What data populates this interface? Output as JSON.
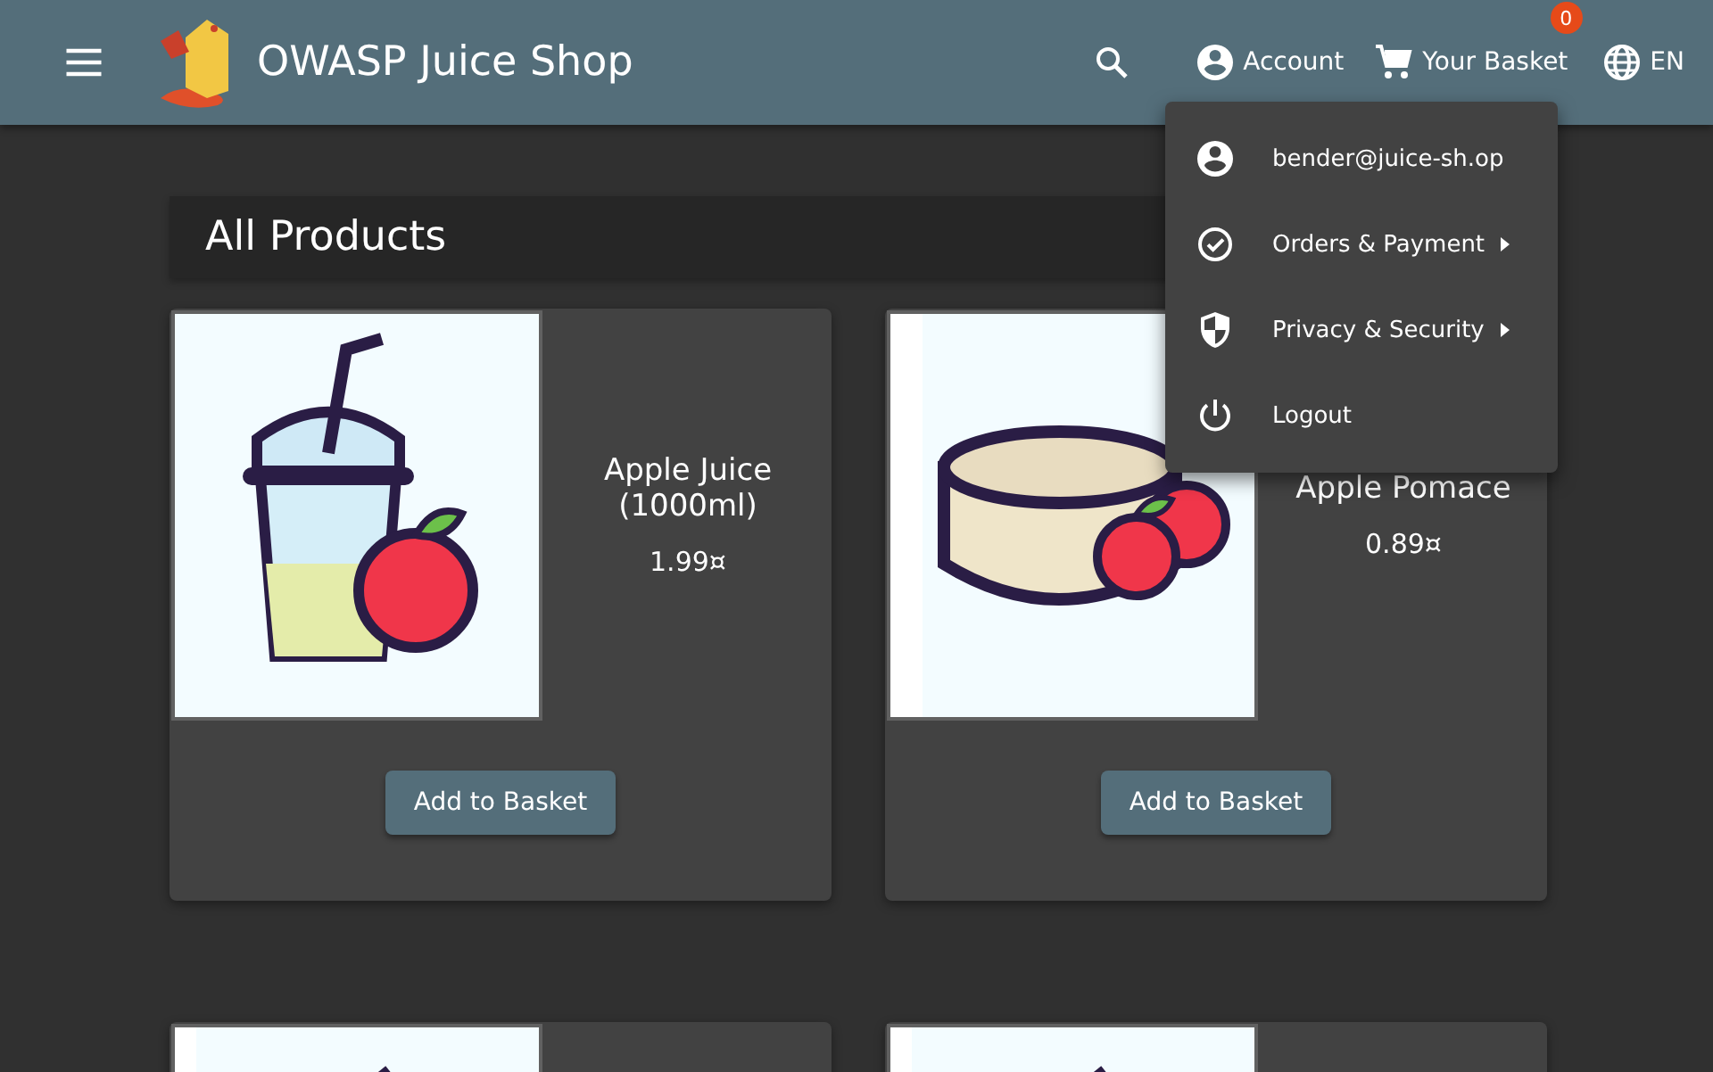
{
  "toolbar": {
    "title": "OWASP Juice Shop",
    "account": "Account",
    "basket": "Your Basket",
    "basket_count": "0",
    "language": "EN"
  },
  "account_menu": {
    "items": [
      {
        "kind": "user",
        "label": "bender@juice-sh.op",
        "submenu": false
      },
      {
        "kind": "orders",
        "label": "Orders & Payment",
        "submenu": true
      },
      {
        "kind": "privacy",
        "label": "Privacy & Security",
        "submenu": true
      },
      {
        "kind": "logout",
        "label": "Logout",
        "submenu": false
      }
    ]
  },
  "heading": "All Products",
  "products": [
    {
      "kind": "juice",
      "name": "Apple Juice (1000ml)",
      "price": "1.99¤",
      "button": "Add to Basket"
    },
    {
      "kind": "pomace",
      "name": "Apple Pomace",
      "price": "0.89¤",
      "button": "Add to Basket"
    },
    {
      "kind": "partial"
    },
    {
      "kind": "partial"
    }
  ]
}
